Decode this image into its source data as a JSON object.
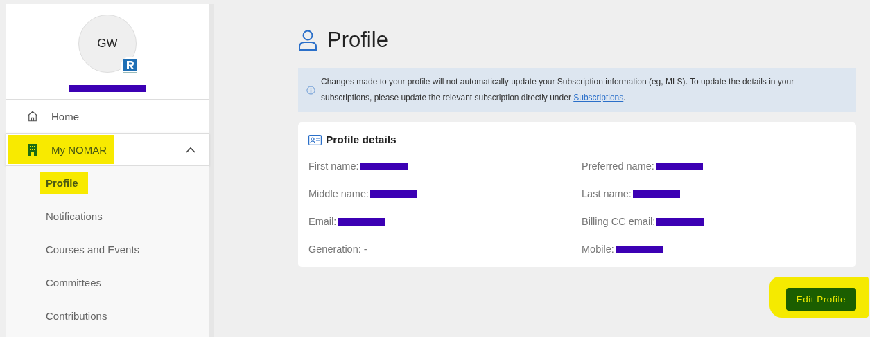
{
  "user": {
    "initials": "GW",
    "name_redacted": true
  },
  "nav": [
    {
      "label": "Home",
      "highlighted": false
    },
    {
      "label": "My NOMAR",
      "highlighted": true,
      "expanded": true,
      "children": [
        {
          "label": "Profile",
          "selected": true,
          "highlighted": true
        },
        {
          "label": "Notifications",
          "selected": false,
          "highlighted": false
        },
        {
          "label": "Courses and Events",
          "selected": false,
          "highlighted": false
        },
        {
          "label": "Committees",
          "selected": false,
          "highlighted": false
        },
        {
          "label": "Contributions",
          "selected": false,
          "highlighted": false
        }
      ]
    }
  ],
  "page_title": "Profile",
  "notice": {
    "text": "Changes made to your profile will not automatically update your Subscription information (eg, MLS). To update the details in your subscriptions, please update the relevant subscription directly under ",
    "link": "Subscriptions",
    "end": "."
  },
  "details": {
    "title": "Profile details",
    "fields": [
      {
        "label": "First name:",
        "redacted": true
      },
      {
        "label": "Preferred name:",
        "redacted": true
      },
      {
        "label": "Middle name:",
        "redacted": true
      },
      {
        "label": "Last name:",
        "redacted": true
      },
      {
        "label": "Email:",
        "redacted": true
      },
      {
        "label": "Billing CC email:",
        "redacted": true
      },
      {
        "label": "Generation:",
        "value": "-"
      },
      {
        "label": "Mobile:",
        "redacted": true
      }
    ]
  },
  "edit_button": {
    "label": "Edit Profile",
    "highlighted": true
  }
}
